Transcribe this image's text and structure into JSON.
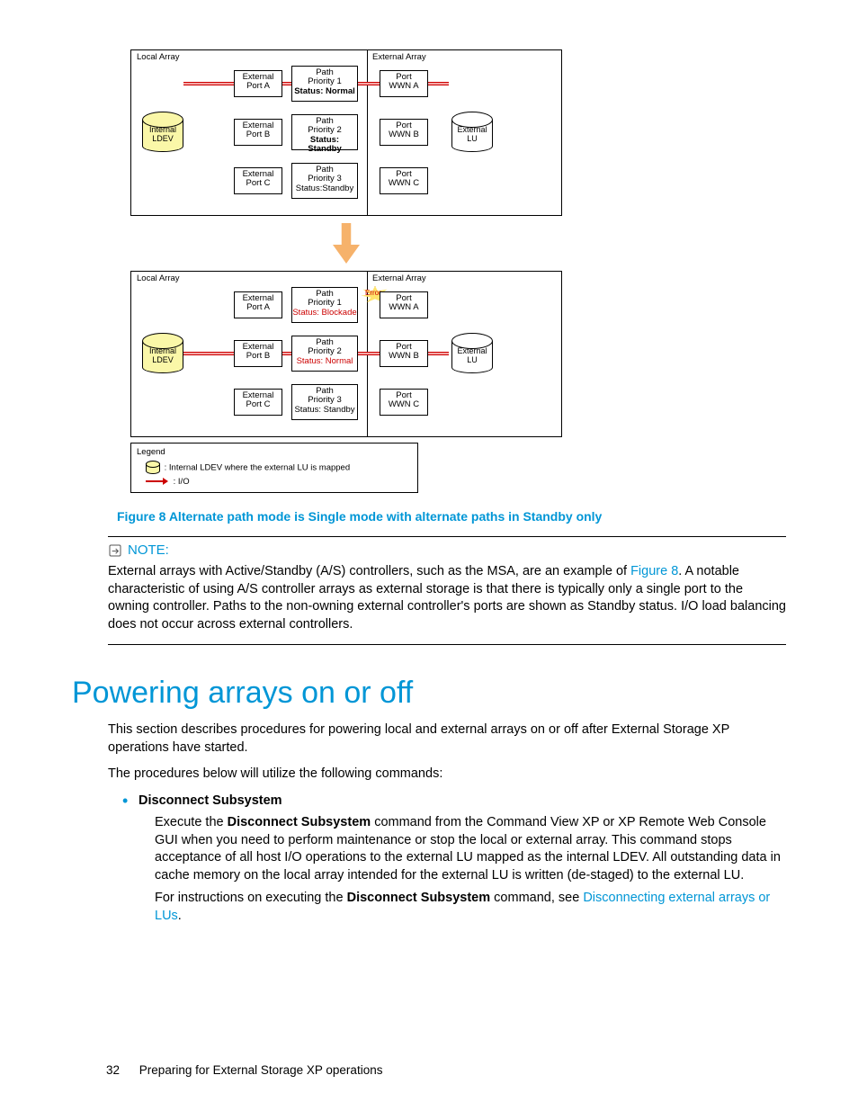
{
  "diagram": {
    "top": {
      "local_label": "Local Array",
      "external_label": "External Array",
      "internal_ldev": "Internal\nLDEV",
      "external_lu": "External\nLU",
      "rows": [
        {
          "ep": "External\nPort A",
          "path_line1": "Path",
          "path_line2": "Priority 1",
          "path_line3": "Status: Normal",
          "port": "Port\nWWN A",
          "status_bold": true
        },
        {
          "ep": "External\nPort B",
          "path_line1": "Path",
          "path_line2": "Priority 2",
          "path_line3": "Status: Standby",
          "port": "Port\nWWN B",
          "status_bold": true
        },
        {
          "ep": "External\nPort C",
          "path_line1": "Path",
          "path_line2": "Priority 3",
          "path_line3": "Status:Standby",
          "port": "Port\nWWN C",
          "status_bold": false
        }
      ]
    },
    "bottom": {
      "local_label": "Local Array",
      "external_label": "External Array",
      "internal_ldev": "Internal\nLDEV",
      "external_lu": "External\nLU",
      "error_label": "Error",
      "rows": [
        {
          "ep": "External\nPort A",
          "path_line1": "Path",
          "path_line2": "Priority 1",
          "path_line3": "Status: Blockade",
          "port": "Port\nWWN A",
          "status_color": "#c00"
        },
        {
          "ep": "External\nPort B",
          "path_line1": "Path",
          "path_line2": "Priority 2",
          "path_line3": "Status: Normal",
          "port": "Port\nWWN B",
          "status_color": "#c00"
        },
        {
          "ep": "External\nPort C",
          "path_line1": "Path",
          "path_line2": "Priority 3",
          "path_line3": "Status: Standby",
          "port": "Port\nWWN C",
          "status_color": "#000"
        }
      ]
    },
    "legend": {
      "title": "Legend",
      "item1": ": Internal LDEV where the external LU is mapped",
      "item2": ": I/O"
    }
  },
  "figure_caption": "Figure 8 Alternate path mode is Single mode with alternate paths in Standby only",
  "note": {
    "heading": "NOTE:",
    "body_pre": "External arrays with Active/Standby (A/S) controllers, such as the MSA, are an example of ",
    "link": "Figure 8",
    "body_post": ". A notable characteristic of using A/S controller arrays as external storage is that there is typically only a single port to the owning controller. Paths to the non-owning external controller's ports are shown as Standby status. I/O load balancing does not occur across external controllers."
  },
  "section_heading": "Powering arrays on or off",
  "para1": "This section describes procedures for powering local and external arrays on or off after External Storage XP operations have started.",
  "para2": "The procedures below will utilize the following commands:",
  "command": {
    "name": "Disconnect Subsystem",
    "p1_a": "Execute the ",
    "p1_b": "Disconnect Subsystem",
    "p1_c": " command from the Command View XP or XP Remote Web Console GUI when you need to perform maintenance or stop the local or external array. This command stops acceptance of all host I/O operations to the external LU mapped as the internal LDEV. All outstanding data in cache memory on the local array intended for the external LU is written (de-staged) to the external LU.",
    "p2_a": "For instructions on executing the ",
    "p2_b": "Disconnect Subsystem",
    "p2_c": " command, see ",
    "p2_link": "Disconnecting external arrays or LUs",
    "p2_d": "."
  },
  "footer": {
    "page": "32",
    "title": "Preparing for External Storage XP operations"
  }
}
